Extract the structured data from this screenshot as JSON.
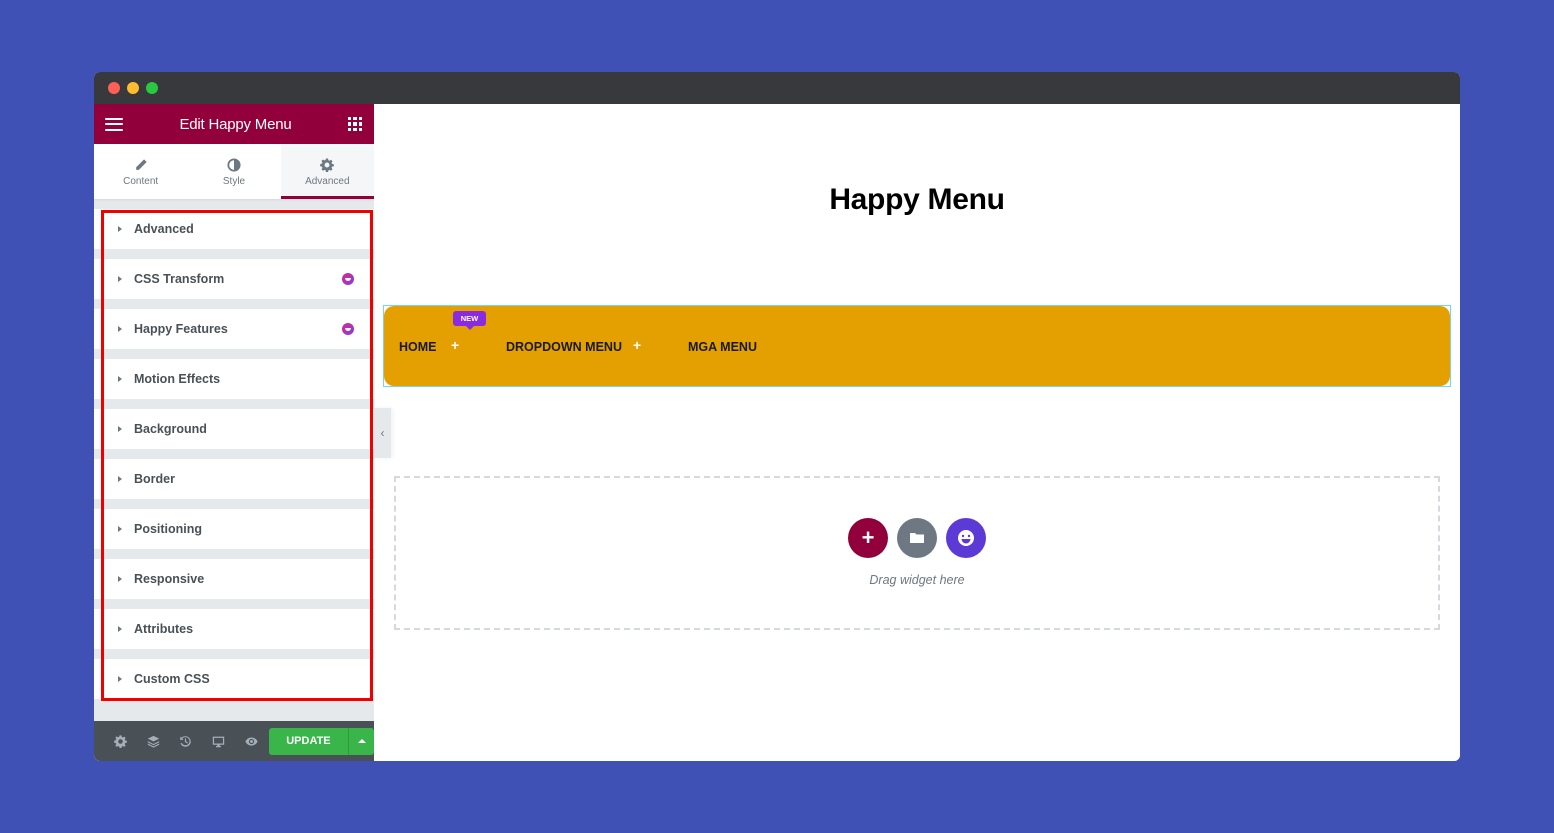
{
  "window": {
    "traffic_lights": [
      "close",
      "minimize",
      "maximize"
    ]
  },
  "sidebar": {
    "title": "Edit Happy Menu",
    "tabs": [
      {
        "label": "Content",
        "icon": "pencil-icon",
        "active": false
      },
      {
        "label": "Style",
        "icon": "contrast-icon",
        "active": false
      },
      {
        "label": "Advanced",
        "icon": "gear-icon",
        "active": true
      }
    ],
    "sections": [
      {
        "label": "Advanced",
        "happy_badge": false
      },
      {
        "label": "CSS Transform",
        "happy_badge": true
      },
      {
        "label": "Happy Features",
        "happy_badge": true
      },
      {
        "label": "Motion Effects",
        "happy_badge": false
      },
      {
        "label": "Background",
        "happy_badge": false
      },
      {
        "label": "Border",
        "happy_badge": false
      },
      {
        "label": "Positioning",
        "happy_badge": false
      },
      {
        "label": "Responsive",
        "happy_badge": false
      },
      {
        "label": "Attributes",
        "happy_badge": false
      },
      {
        "label": "Custom CSS",
        "happy_badge": false
      }
    ],
    "footer": {
      "icons": [
        "settings-icon",
        "layers-icon",
        "history-icon",
        "responsive-icon",
        "preview-icon"
      ],
      "update_label": "UPDATE"
    }
  },
  "canvas": {
    "page_title": "Happy Menu",
    "menu": {
      "items": [
        {
          "label": "HOME",
          "has_submenu": true,
          "badge": "NEW"
        },
        {
          "label": "DROPDOWN MENU",
          "has_submenu": true
        },
        {
          "label": "MGA MENU",
          "has_submenu": false
        }
      ],
      "plus_symbol": "+"
    },
    "dropzone": {
      "text": "Drag widget here",
      "add_symbol": "+"
    }
  },
  "colors": {
    "brand": "#92003b",
    "menu_bg": "#e3a000",
    "update_green": "#39b54a",
    "highlight_red": "#f20000",
    "badge_purple": "#8a2be2",
    "page_bg": "#4051b5"
  }
}
